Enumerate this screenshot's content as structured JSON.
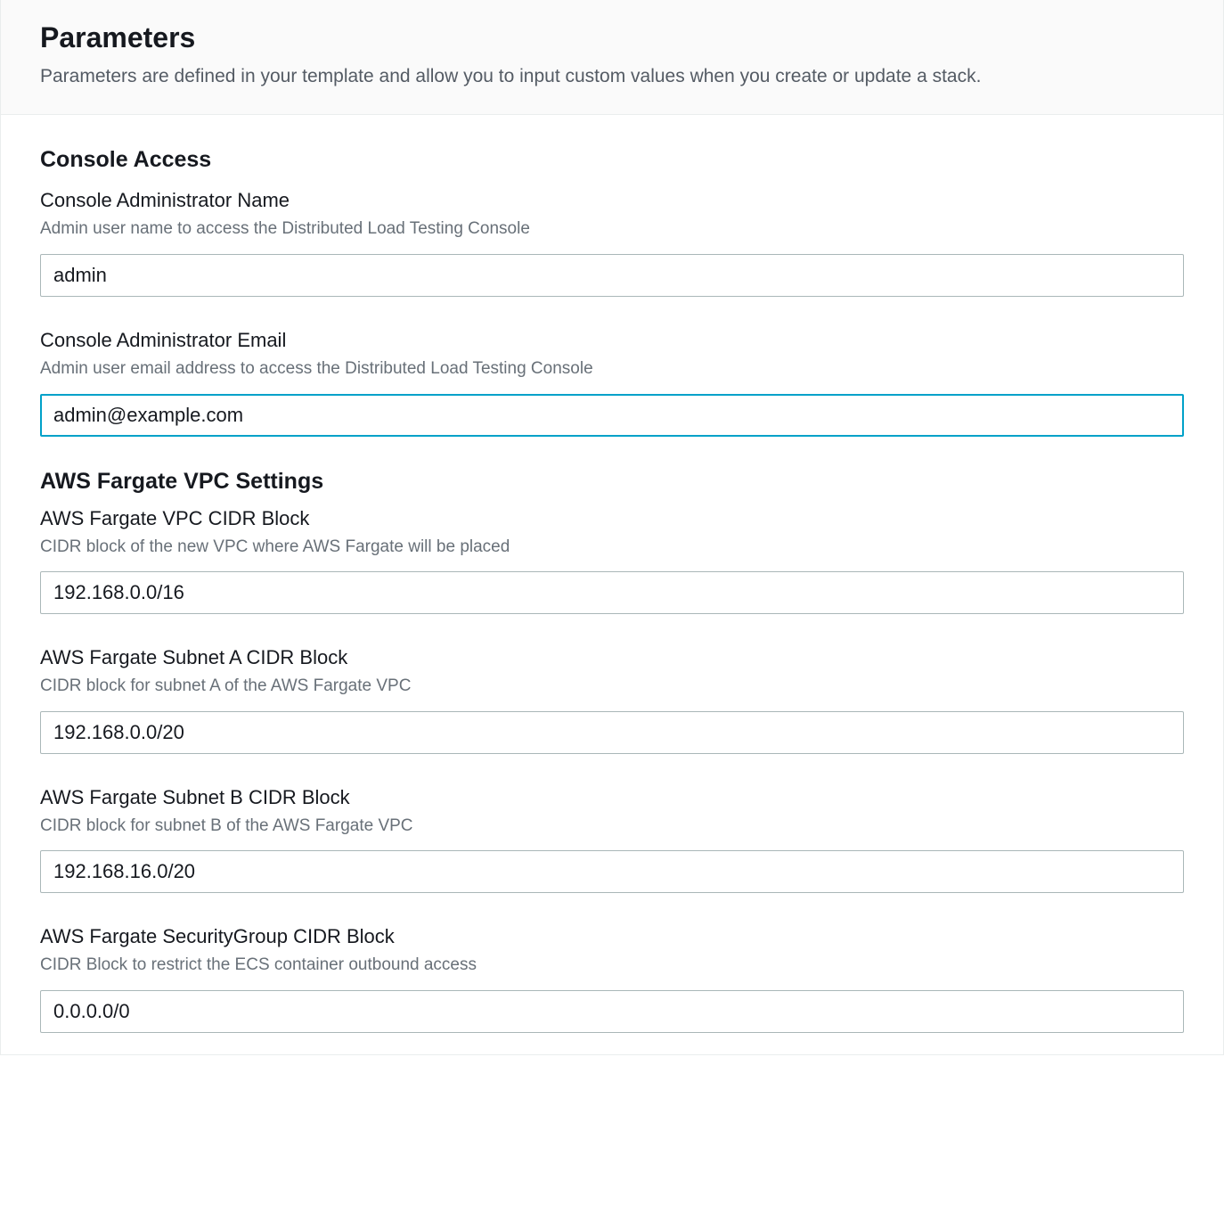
{
  "header": {
    "title": "Parameters",
    "description": "Parameters are defined in your template and allow you to input custom values when you create or update a stack."
  },
  "sections": {
    "console_access": {
      "title": "Console Access",
      "fields": {
        "admin_name": {
          "label": "Console Administrator Name",
          "hint": "Admin user name to access the Distributed Load Testing Console",
          "value": "admin"
        },
        "admin_email": {
          "label": "Console Administrator Email",
          "hint": "Admin user email address to access the Distributed Load Testing Console",
          "value": "admin@example.com"
        }
      }
    },
    "fargate_vpc": {
      "title": "AWS Fargate VPC Settings",
      "fields": {
        "vpc_cidr": {
          "label": "AWS Fargate VPC CIDR Block",
          "hint": "CIDR block of the new VPC where AWS Fargate will be placed",
          "value": "192.168.0.0/16"
        },
        "subnet_a": {
          "label": "AWS Fargate Subnet A CIDR Block",
          "hint": "CIDR block for subnet A of the AWS Fargate VPC",
          "value": "192.168.0.0/20"
        },
        "subnet_b": {
          "label": "AWS Fargate Subnet B CIDR Block",
          "hint": "CIDR block for subnet B of the AWS Fargate VPC",
          "value": "192.168.16.0/20"
        },
        "security_group": {
          "label": "AWS Fargate SecurityGroup CIDR Block",
          "hint": "CIDR Block to restrict the ECS container outbound access",
          "value": "0.0.0.0/0"
        }
      }
    }
  }
}
